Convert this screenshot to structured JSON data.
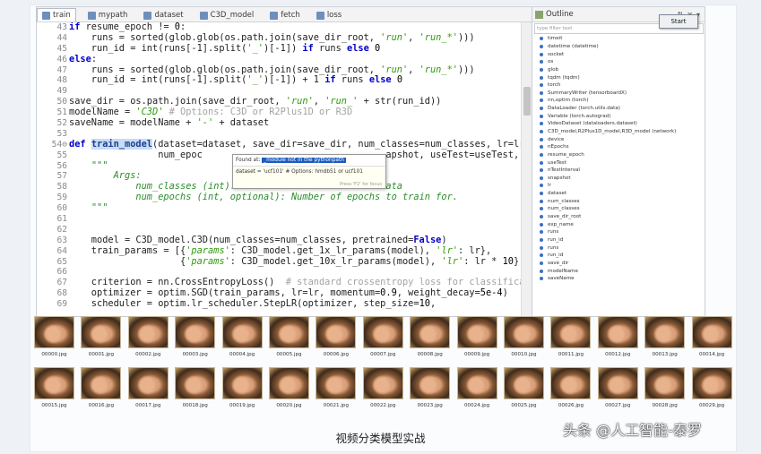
{
  "tabs": [
    {
      "label": "train",
      "active": true,
      "icon": "python-file-icon"
    },
    {
      "label": "mypath",
      "active": false,
      "icon": "python-file-icon"
    },
    {
      "label": "dataset",
      "active": false,
      "icon": "python-file-icon"
    },
    {
      "label": "C3D_model",
      "active": false,
      "icon": "python-file-icon"
    },
    {
      "label": "fetch",
      "active": false,
      "icon": "python-file-icon"
    },
    {
      "label": "loss",
      "active": false,
      "icon": "python-file-icon"
    }
  ],
  "code_lines": [
    {
      "n": "43",
      "html": "<span class='kw'>if</span> resume_epoch != <span class='num'>0</span>:"
    },
    {
      "n": "44",
      "html": "    runs = sorted(glob.glob(os.path.join(save_dir_root, <span class='str'>'run'</span>, <span class='str'>'run_*'</span>)))"
    },
    {
      "n": "45",
      "html": "    run_id = int(runs[-1].split(<span class='str'>'_'</span>)[-1]) <span class='kw'>if</span> runs <span class='kw'>else</span> <span class='num'>0</span>"
    },
    {
      "n": "46",
      "html": "<span class='kw'>else</span>:"
    },
    {
      "n": "47",
      "html": "    runs = sorted(glob.glob(os.path.join(save_dir_root, <span class='str'>'run'</span>, <span class='str'>'run_*'</span>)))"
    },
    {
      "n": "48",
      "html": "    run_id = int(runs[-1].split(<span class='str'>'_'</span>)[-1]) + 1 <span class='kw'>if</span> runs <span class='kw'>else</span> <span class='num'>0</span>"
    },
    {
      "n": "49",
      "html": ""
    },
    {
      "n": "50",
      "html": "save_dir = os.path.join(save_dir_root, <span class='str'>'run'</span>, <span class='str'>'run_'</span> + str(run_id))"
    },
    {
      "n": "51",
      "html": "modelName = <span class='str'>'C3D'</span> <span class='cmt'># Options: C3D or R2Plus1D or R3D</span>"
    },
    {
      "n": "52",
      "html": "saveName = modelName + <span class='str'>'-'</span> + dataset"
    },
    {
      "n": "53",
      "html": ""
    },
    {
      "n": "54⊖",
      "html": "<span class='kw'>def</span> <span class='fn'>train_model</span>(dataset=dataset, save_dir=save_dir, num_classes=num_classes, lr=lr,"
    },
    {
      "n": "55",
      "html": "                num_epoc                                 apshot, useTest=useTest, test_interv"
    },
    {
      "n": "56",
      "html": "    <span class='doc'>\"\"\"</span>"
    },
    {
      "n": "57",
      "html": "        <span class='doc'>Args:</span>"
    },
    {
      "n": "58",
      "html": "            <span class='doc'>num_classes (int): Number of classes in the data</span>"
    },
    {
      "n": "59",
      "html": "            <span class='doc'>num_epochs (int, optional): Number of epochs to train for.</span>"
    },
    {
      "n": "60",
      "html": "    <span class='doc'>\"\"\"</span>"
    },
    {
      "n": "61",
      "html": ""
    },
    {
      "n": "62",
      "html": ""
    },
    {
      "n": "63",
      "html": "    model = C3D_model.C3D(num_classes=num_classes, pretrained=<span class='kw'>False</span>)"
    },
    {
      "n": "64",
      "html": "    train_params = [{<span class='str'>'params'</span>: C3D_model.get_1x_lr_params(model), <span class='str'>'lr'</span>: lr},"
    },
    {
      "n": "65",
      "html": "                    {<span class='str'>'params'</span>: C3D_model.get_10x_lr_params(model), <span class='str'>'lr'</span>: lr * <span class='num'>10</span>}]"
    },
    {
      "n": "66",
      "html": ""
    },
    {
      "n": "67",
      "html": "    criterion = nn.CrossEntropyLoss()  <span class='cmt'># standard crossentropy loss for classificatio</span>"
    },
    {
      "n": "68",
      "html": "    optimizer = optim.SGD(train_params, lr=lr, momentum=<span class='num'>0.9</span>, weight_decay=<span class='num'>5e-4</span>)"
    },
    {
      "n": "69",
      "html": "    scheduler = optim.lr_scheduler.StepLR(optimizer, step_size=<span class='num'>10</span>,"
    }
  ],
  "popup": {
    "found_prefix": "Found at:",
    "found_text": "_module not in the pythonpath",
    "body": "dataset = 'ucf101' # Options: hmdb51 or ucf101",
    "hint": "Press 'F2' for focus"
  },
  "outline": {
    "title": "Outline",
    "filter_placeholder": "type filter text",
    "start_label": "Start",
    "items": [
      "timeit",
      "datetime (datetime)",
      "socket",
      "os",
      "glob",
      "tqdm (tqdm)",
      "torch",
      "SummaryWriter (tensorboardX)",
      "nn,optim (torch)",
      "DataLoader (torch.utils.data)",
      "Variable (torch.autograd)",
      "VideoDataset (dataloaders.dataset)",
      "C3D_model,R2Plus1D_model,R3D_model (network)",
      "device",
      "nEpochs",
      "resume_epoch",
      "useTest",
      "nTestInterval",
      "snapshot",
      "lr",
      "dataset",
      "num_classes",
      "num_classes",
      "save_dir_root",
      "exp_name",
      "runs",
      "run_id",
      "runs",
      "run_id",
      "save_dir",
      "modelName",
      "saveName"
    ]
  },
  "thumbnails": [
    "00000.jpg",
    "00001.jpg",
    "00002.jpg",
    "00003.jpg",
    "00004.jpg",
    "00005.jpg",
    "00006.jpg",
    "00007.jpg",
    "00008.jpg",
    "00009.jpg",
    "00010.jpg",
    "00011.jpg",
    "00012.jpg",
    "00013.jpg",
    "00014.jpg",
    "00015.jpg",
    "00016.jpg",
    "00017.jpg",
    "00018.jpg",
    "00019.jpg",
    "00020.jpg",
    "00021.jpg",
    "00022.jpg",
    "00023.jpg",
    "00024.jpg",
    "00025.jpg",
    "00026.jpg",
    "00027.jpg",
    "00028.jpg",
    "00029.jpg"
  ],
  "caption": "视频分类模型实战",
  "watermark": "头条 @人工智能-泰罗"
}
